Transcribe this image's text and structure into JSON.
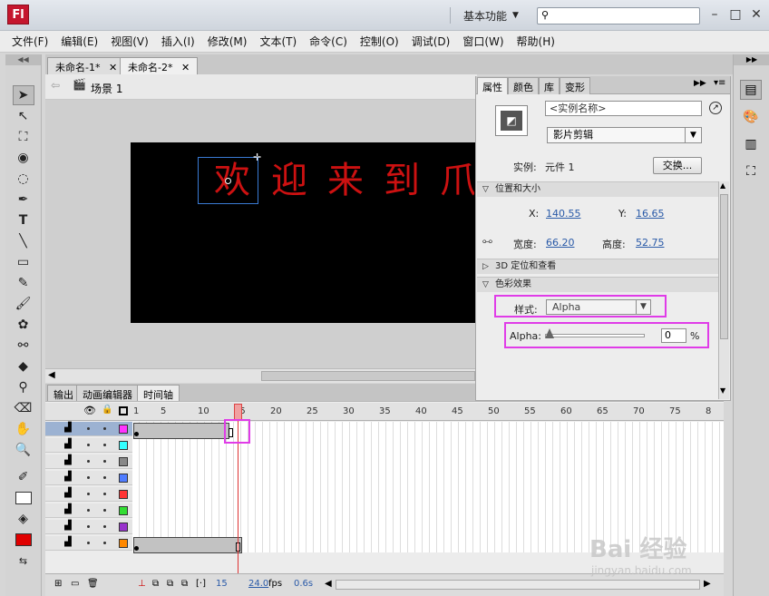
{
  "app": {
    "logo": "Fl",
    "workspace": "基本功能",
    "search_placeholder": ""
  },
  "menus": [
    "文件(F)",
    "编辑(E)",
    "视图(V)",
    "插入(I)",
    "修改(M)",
    "文本(T)",
    "命令(C)",
    "控制(O)",
    "调试(D)",
    "窗口(W)",
    "帮助(H)"
  ],
  "doc_tabs": [
    "未命名-1*",
    "未命名-2*"
  ],
  "scene": {
    "label": "场景 1"
  },
  "stage": {
    "chars": [
      "欢",
      "迎",
      "来",
      "到",
      "爪"
    ]
  },
  "bottom_tabs": [
    "输出",
    "动画编辑器",
    "时间轴"
  ],
  "timeline": {
    "frame_numbers": [
      "1",
      "5",
      "10",
      "15",
      "20",
      "25",
      "30",
      "35",
      "40",
      "45",
      "50",
      "55",
      "60",
      "65",
      "70",
      "75",
      "8"
    ],
    "fps": "24.0",
    "fps_unit": "fps",
    "time": "0.6s",
    "current_frame": "15",
    "layer_colors": [
      "#ff33ff",
      "#33ffff",
      "#888888",
      "#4f7cff",
      "#ff3333",
      "#33dd33",
      "#9933cc",
      "#ff8800"
    ]
  },
  "properties": {
    "tabs": [
      "属性",
      "颜色",
      "库",
      "变形"
    ],
    "instance_name_placeholder": "<实例名称>",
    "type_value": "影片剪辑",
    "instance_label": "实例:",
    "instance_value": "元件 1",
    "swap_button": "交换...",
    "section_position": "位置和大小",
    "x_label": "X:",
    "x_value": "140.55",
    "y_label": "Y:",
    "y_value": "16.65",
    "width_label": "宽度:",
    "width_value": "66.20",
    "height_label": "高度:",
    "height_value": "52.75",
    "section_3d": "3D 定位和查看",
    "section_color": "色彩效果",
    "style_label": "样式:",
    "style_value": "Alpha",
    "alpha_label": "Alpha:",
    "alpha_value": "0",
    "alpha_unit": "%"
  },
  "watermark": {
    "brand": "Bai 经验",
    "url": "jingyan.baidu.com"
  }
}
